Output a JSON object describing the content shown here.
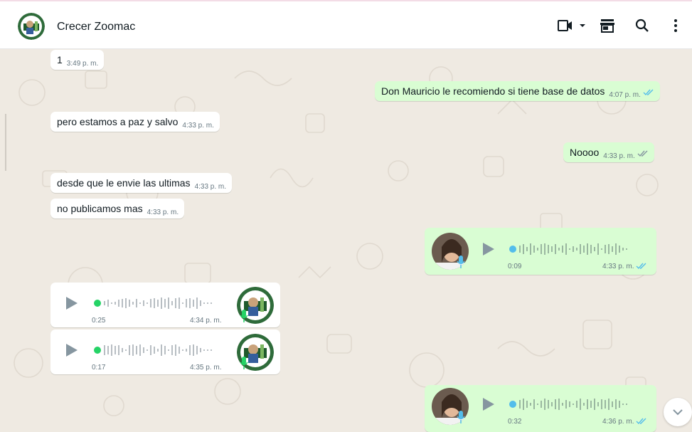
{
  "header": {
    "contact_name": "Crecer Zoomac"
  },
  "messages": [
    {
      "dir": "in",
      "text": "1",
      "time": "3:49 p. m."
    },
    {
      "dir": "out",
      "text": "Don Mauricio le recomiendo si tiene base de datos",
      "time": "4:07 p. m."
    },
    {
      "dir": "in",
      "text": "pero estamos a paz y salvo",
      "time": "4:33 p. m."
    },
    {
      "dir": "out",
      "text": "Noooo",
      "time": "4:33 p. m."
    },
    {
      "dir": "in",
      "text": "desde que le envie las ultimas",
      "time": "4:33 p. m."
    },
    {
      "dir": "in",
      "text": "no publicamos mas",
      "time": "4:33 p. m."
    }
  ],
  "audios": [
    {
      "dir": "out",
      "duration": "0:09",
      "time": "4:33 p. m."
    },
    {
      "dir": "in",
      "duration": "0:25",
      "time": "4:34 p. m."
    },
    {
      "dir": "in",
      "duration": "0:17",
      "time": "4:35 p. m."
    },
    {
      "dir": "out",
      "duration": "0:32",
      "time": "4:36 p. m."
    }
  ],
  "colors": {
    "incoming": "#ffffff",
    "outgoing": "#d9fdd3",
    "read_tick": "#53bdeb",
    "sent_tick": "#8696a0",
    "wave_active": "#25d366",
    "wave_out_dot": "#53bdeb"
  },
  "icons": [
    "video-call-icon",
    "chevron-down-icon",
    "shop-icon",
    "search-icon",
    "more-vert-icon",
    "play-icon",
    "mic-icon",
    "double-tick-icon",
    "scroll-down-icon"
  ]
}
